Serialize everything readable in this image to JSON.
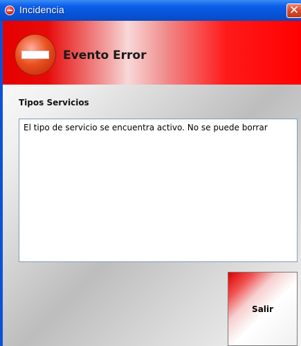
{
  "window": {
    "title": "Incidencia"
  },
  "header": {
    "title": "Evento Error"
  },
  "section": {
    "label": "Tipos Servicios"
  },
  "message": {
    "text": "El tipo de servicio se encuentra activo. No se puede borrar"
  },
  "actions": {
    "exit_label": "Salir"
  },
  "icons": {
    "title_icon": "error-icon",
    "close_icon": "close-icon",
    "header_icon": "stop-error-icon"
  },
  "colors": {
    "titlebar": "#0852d6",
    "header_red": "#e80000",
    "close_button": "#d8482a"
  }
}
